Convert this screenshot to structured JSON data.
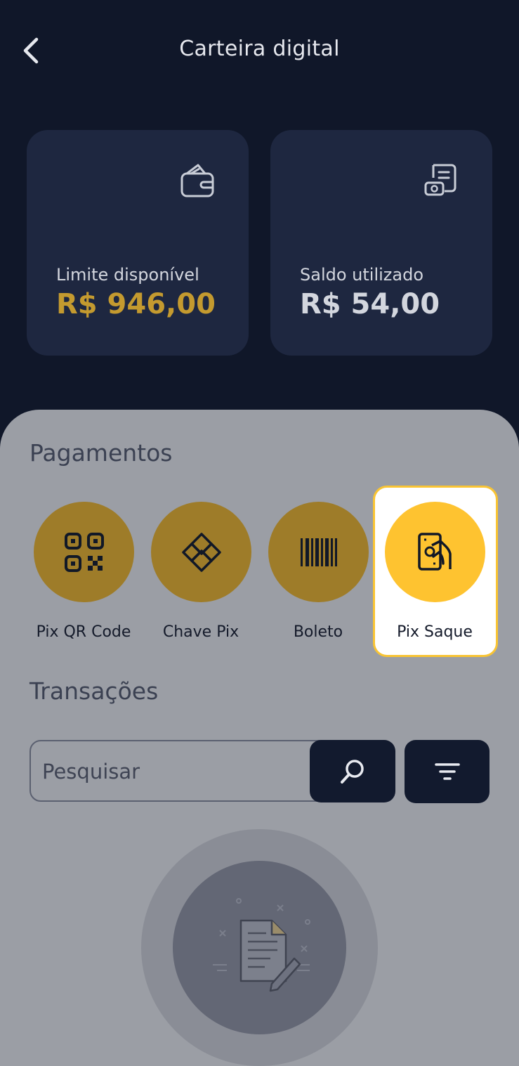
{
  "header": {
    "title": "Carteira digital"
  },
  "cards": [
    {
      "label": "Limite disponível",
      "value": "R$ 946,00",
      "icon": "wallet-icon",
      "value_color": "#c49a2f"
    },
    {
      "label": "Saldo utilizado",
      "value": "R$ 54,00",
      "icon": "bill-icon",
      "value_color": "#d3d6de"
    }
  ],
  "payments": {
    "title": "Pagamentos",
    "items": [
      {
        "label": "Pix QR Code",
        "icon": "qr-code-icon"
      },
      {
        "label": "Chave Pix",
        "icon": "pix-icon"
      },
      {
        "label": "Boleto",
        "icon": "barcode-icon"
      },
      {
        "label": "Pix Saque",
        "icon": "cash-withdraw-icon",
        "selected": true
      }
    ]
  },
  "transactions": {
    "title": "Transações",
    "search_placeholder": "Pesquisar"
  },
  "colors": {
    "header_bg": "#101729",
    "card_bg": "#1e2740",
    "accent": "#fec330",
    "accent_muted": "#9e7c29",
    "button_dark": "#121a2e"
  }
}
